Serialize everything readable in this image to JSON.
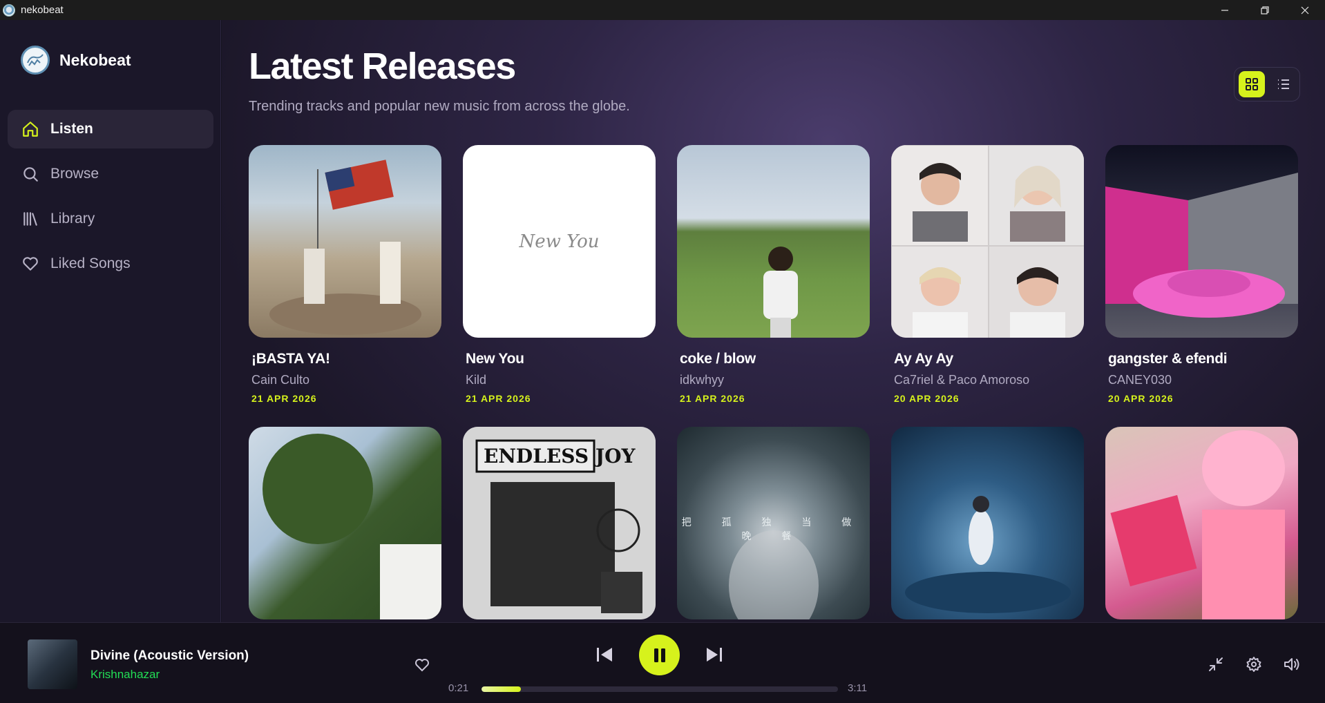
{
  "window": {
    "title": "nekobeat"
  },
  "brand": {
    "name": "Nekobeat"
  },
  "sidebar": {
    "items": [
      {
        "label": "Listen",
        "icon": "home-icon",
        "active": true
      },
      {
        "label": "Browse",
        "icon": "search-icon",
        "active": false
      },
      {
        "label": "Library",
        "icon": "library-icon",
        "active": false
      },
      {
        "label": "Liked Songs",
        "icon": "heart-icon",
        "active": false
      }
    ]
  },
  "main": {
    "title": "Latest Releases",
    "subtitle": "Trending tracks and popular new music from across the globe.",
    "view_modes": [
      "grid-view",
      "list-view"
    ],
    "active_view": "grid-view",
    "releases": [
      {
        "title": "¡BASTA YA!",
        "artist": "Cain Culto",
        "date": "21 APR 2026"
      },
      {
        "title": "New You",
        "artist": "Kild",
        "date": "21 APR 2026",
        "cover_text": "New You"
      },
      {
        "title": "coke / blow",
        "artist": "idkwhyy",
        "date": "21 APR 2026"
      },
      {
        "title": "Ay Ay Ay",
        "artist": "Ca7riel & Paco Amoroso",
        "date": "20 APR 2026"
      },
      {
        "title": "gangster & efendi",
        "artist": "CANEY030",
        "date": "20 APR 2026"
      },
      {
        "title": "",
        "artist": "",
        "date": ""
      },
      {
        "title": "",
        "artist": "",
        "date": "",
        "cover_text": "ENDLESS JOY"
      },
      {
        "title": "",
        "artist": "",
        "date": "",
        "cover_text": "把 孤 独 当 做 晚 餐"
      },
      {
        "title": "",
        "artist": "",
        "date": ""
      },
      {
        "title": "",
        "artist": "",
        "date": ""
      }
    ]
  },
  "player": {
    "track_title": "Divine (Acoustic Version)",
    "track_artist": "Krishnahazar",
    "current_time": "0:21",
    "total_time": "3:11",
    "progress_fraction": 0.11,
    "state": "playing"
  },
  "colors": {
    "accent": "#d6f21c",
    "artist_link": "#22dd55",
    "sidebar_bg": "#1b1729",
    "player_bg": "#14111c"
  }
}
